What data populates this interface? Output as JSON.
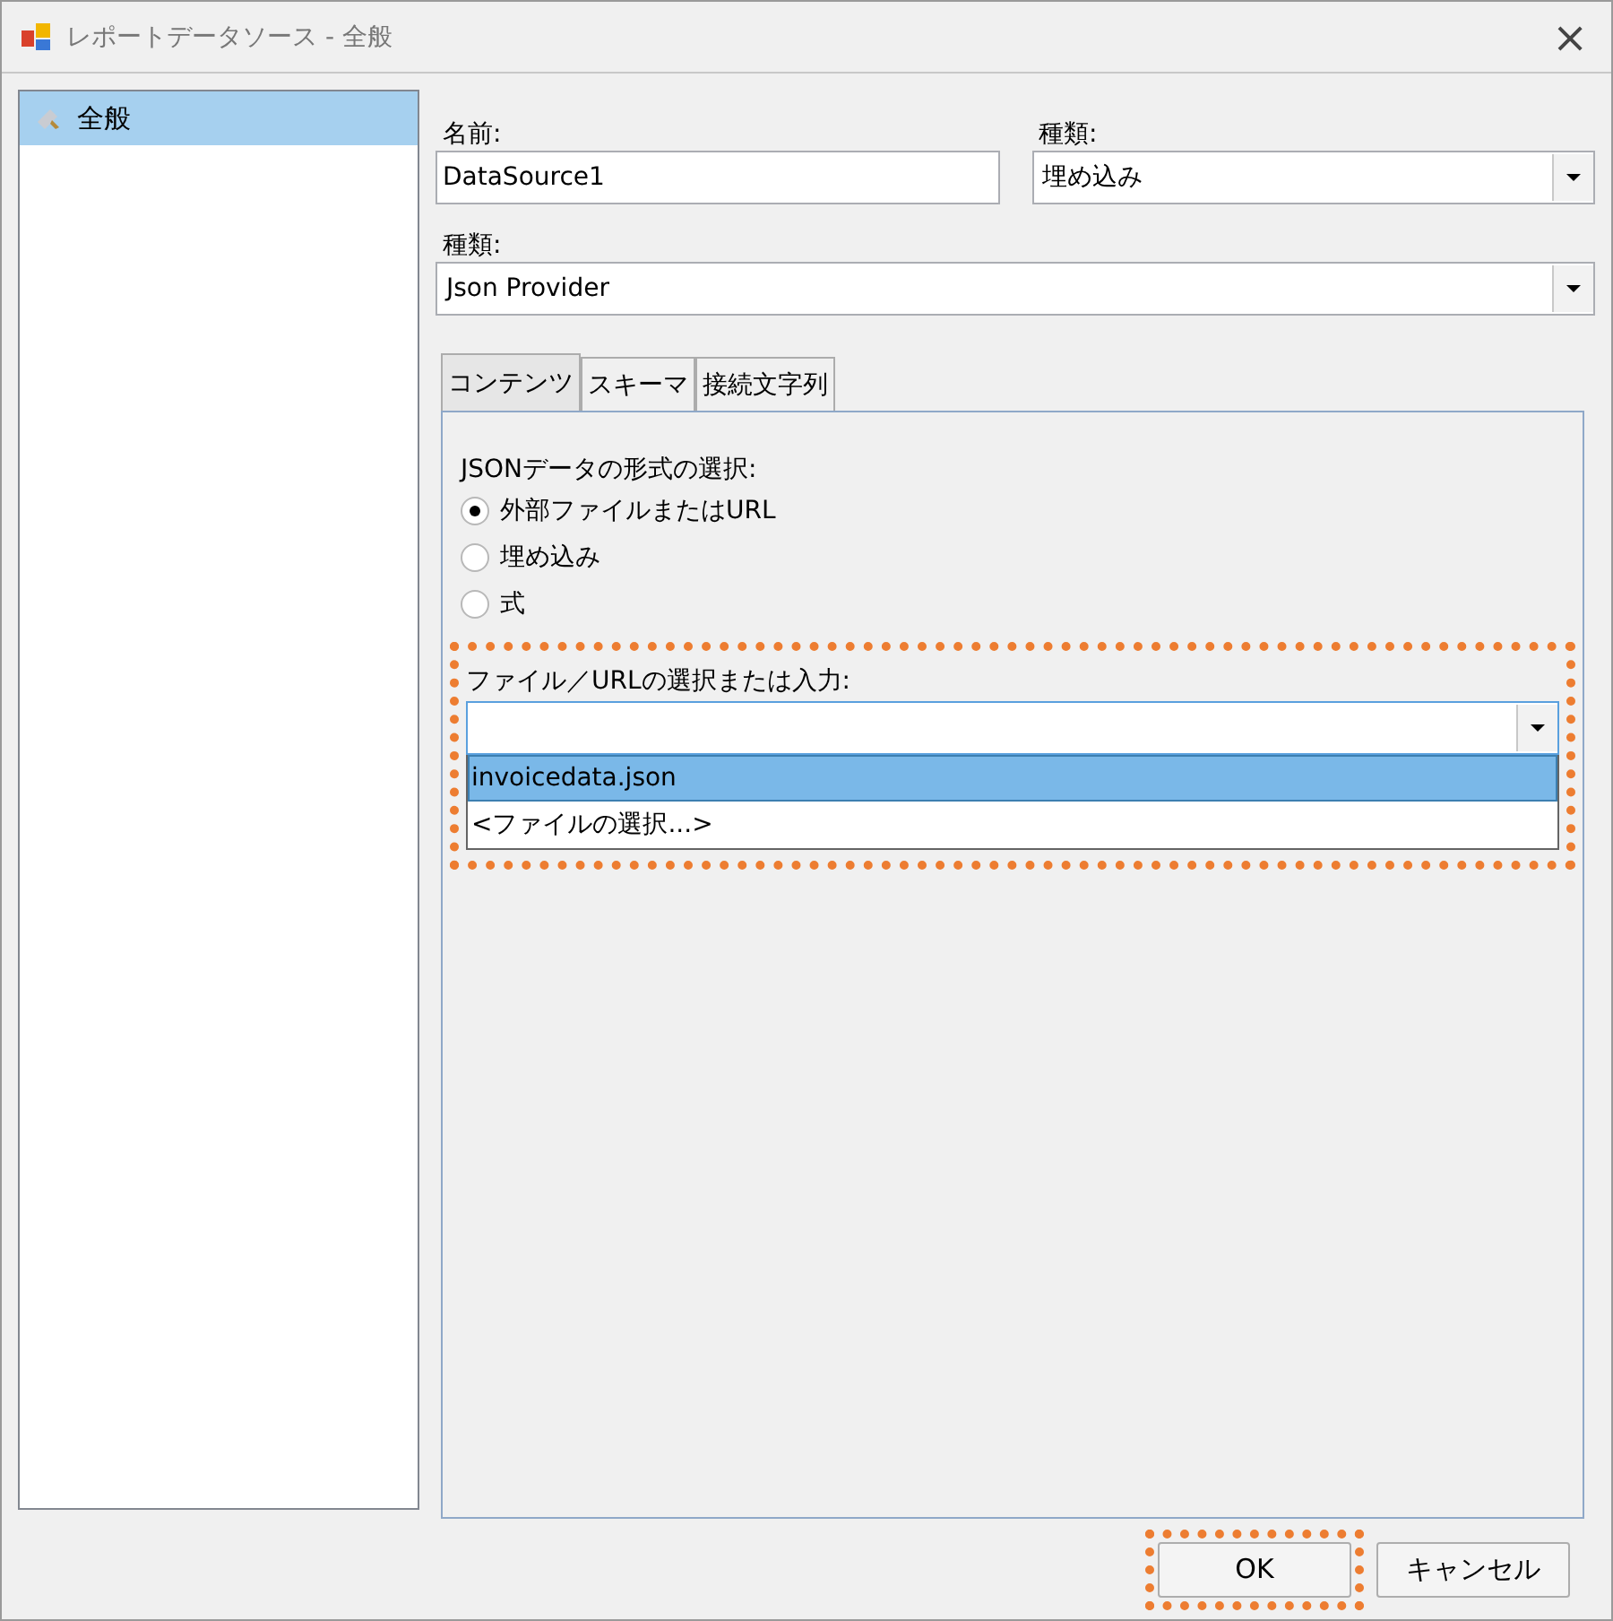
{
  "window": {
    "title": "レポートデータソース - 全般",
    "close": "×"
  },
  "sidebar": {
    "items": [
      {
        "label": "全般",
        "selected": true
      }
    ]
  },
  "name_field": {
    "label": "名前:",
    "value": "DataSource1"
  },
  "type_field": {
    "label": "種類:",
    "value": "埋め込み"
  },
  "provider_field": {
    "label": "種類:",
    "value": "Json Provider"
  },
  "tabs": [
    {
      "label": "コンテンツ",
      "selected": true
    },
    {
      "label": "スキーマ",
      "selected": false
    },
    {
      "label": "接続文字列",
      "selected": false
    }
  ],
  "content": {
    "format_label": "JSONデータの形式の選択:",
    "radios": [
      {
        "label": "外部ファイルまたはURL",
        "selected": true
      },
      {
        "label": "埋め込み",
        "selected": false
      },
      {
        "label": "式",
        "selected": false
      }
    ],
    "file_section": {
      "label": "ファイル／URLの選択または入力:",
      "highlighted": true,
      "options": [
        {
          "label": "invoicedata.json",
          "selected": true
        },
        {
          "label": "<ファイルの選択...>",
          "selected": false
        }
      ]
    }
  },
  "buttons": [
    {
      "label": "OK",
      "highlighted": true
    },
    {
      "label": "キャンセル",
      "highlighted": false
    }
  ]
}
